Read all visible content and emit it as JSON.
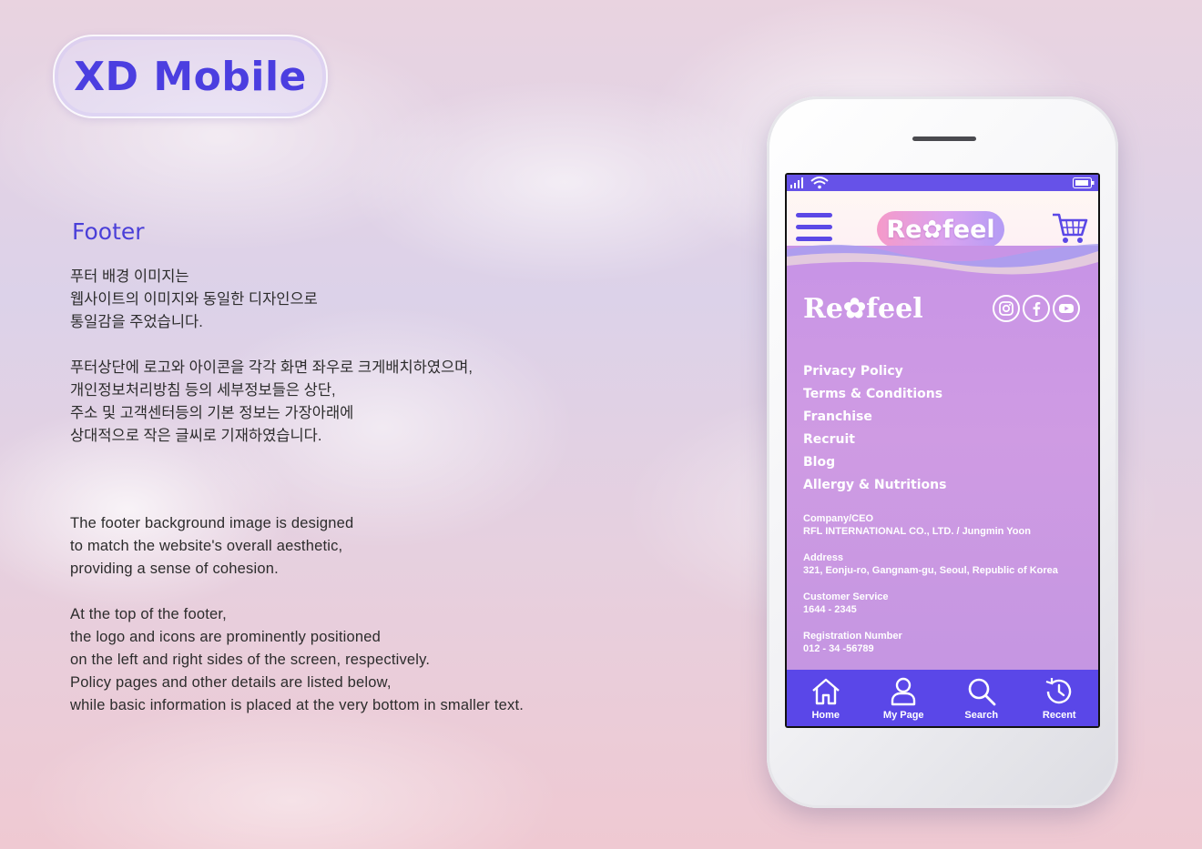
{
  "title": "XD Mobile",
  "section": "Footer",
  "korean": {
    "para1": [
      "푸터 배경 이미지는",
      "웹사이트의 이미지와 동일한 디자인으로",
      "통일감을 주었습니다."
    ],
    "para2": [
      "푸터상단에 로고와 아이콘을 각각 화면 좌우로 크게배치하였으며,",
      "개인정보처리방침 등의 세부정보들은 상단,",
      "주소 및 고객센터등의 기본 정보는 가장아래에",
      "상대적으로 작은 글씨로 기재하였습니다."
    ]
  },
  "english": {
    "para1": [
      "The footer background image is designed",
      "to match the website's overall aesthetic,",
      "providing a sense of cohesion."
    ],
    "para2": [
      "At the top of the footer,",
      "the logo and icons are prominently positioned",
      "on the left and right sides of the screen, respectively.",
      "Policy pages and other details are listed below,",
      "while basic information is placed at the very bottom in smaller text."
    ]
  },
  "phone": {
    "header_logo": "Re✿feel",
    "footer_logo": "Re✿feel",
    "social_icons": [
      "instagram-icon",
      "facebook-icon",
      "youtube-icon"
    ],
    "links": [
      "Privacy Policy",
      "Terms & Conditions",
      "Franchise",
      "Recruit",
      "Blog",
      "Allergy & Nutritions"
    ],
    "info": [
      {
        "label": "Company/CEO",
        "value": "RFL INTERNATIONAL CO., LTD. / Jungmin Yoon"
      },
      {
        "label": "Address",
        "value": "321, Eonju-ro, Gangnam-gu, Seoul, Republic of Korea"
      },
      {
        "label": "Customer Service",
        "value": "1644 - 2345"
      },
      {
        "label": "Registration Number",
        "value": "012 - 34 -56789"
      }
    ],
    "tabs": [
      {
        "label": "Home",
        "icon": "home-icon"
      },
      {
        "label": "My Page",
        "icon": "user-icon"
      },
      {
        "label": "Search",
        "icon": "search-icon"
      },
      {
        "label": "Recent",
        "icon": "history-icon"
      }
    ]
  },
  "colors": {
    "accent": "#4b3ee0",
    "tabbar": "#5a47e8",
    "footer": "#c894e6"
  }
}
